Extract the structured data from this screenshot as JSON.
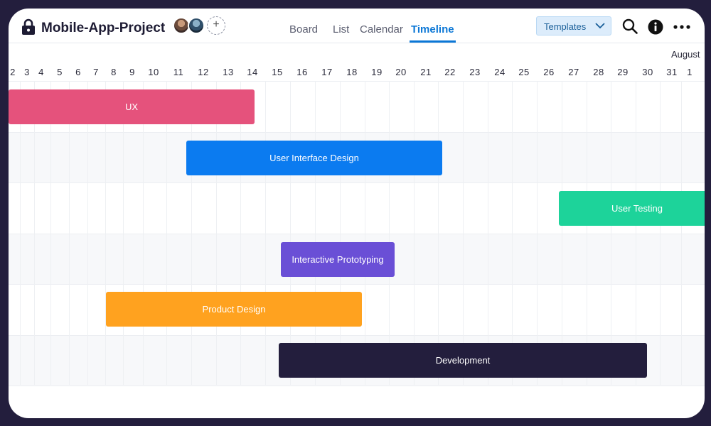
{
  "header": {
    "title": "Mobile-App-Project",
    "add_member_label": "+",
    "tabs": [
      {
        "label": "Board"
      },
      {
        "label": "List"
      },
      {
        "label": "Calendar"
      },
      {
        "label": "Timeline",
        "active": true
      }
    ],
    "templates_label": "Templates"
  },
  "timeline": {
    "month_label": "August",
    "days": [
      "2",
      "3",
      "4",
      "5",
      "6",
      "7",
      "8",
      "9",
      "10",
      "11",
      "12",
      "13",
      "14",
      "15",
      "16",
      "17",
      "18",
      "19",
      "20",
      "21",
      "22",
      "23",
      "24",
      "25",
      "26",
      "27",
      "28",
      "29",
      "30",
      "31",
      "1"
    ],
    "tasks": [
      {
        "label": "UX",
        "color": "#e5527c"
      },
      {
        "label": "User Interface Design",
        "color": "#0b7bf0"
      },
      {
        "label": "User Testing",
        "color": "#1dd39a"
      },
      {
        "label": "Interactive Prototyping",
        "color": "#6a4fd6"
      },
      {
        "label": "Product Design",
        "color": "#ffa21f"
      },
      {
        "label": "Development",
        "color": "#231e3d"
      }
    ]
  },
  "colors": {
    "accent": "#0b77d6",
    "frame": "#231e3d"
  }
}
